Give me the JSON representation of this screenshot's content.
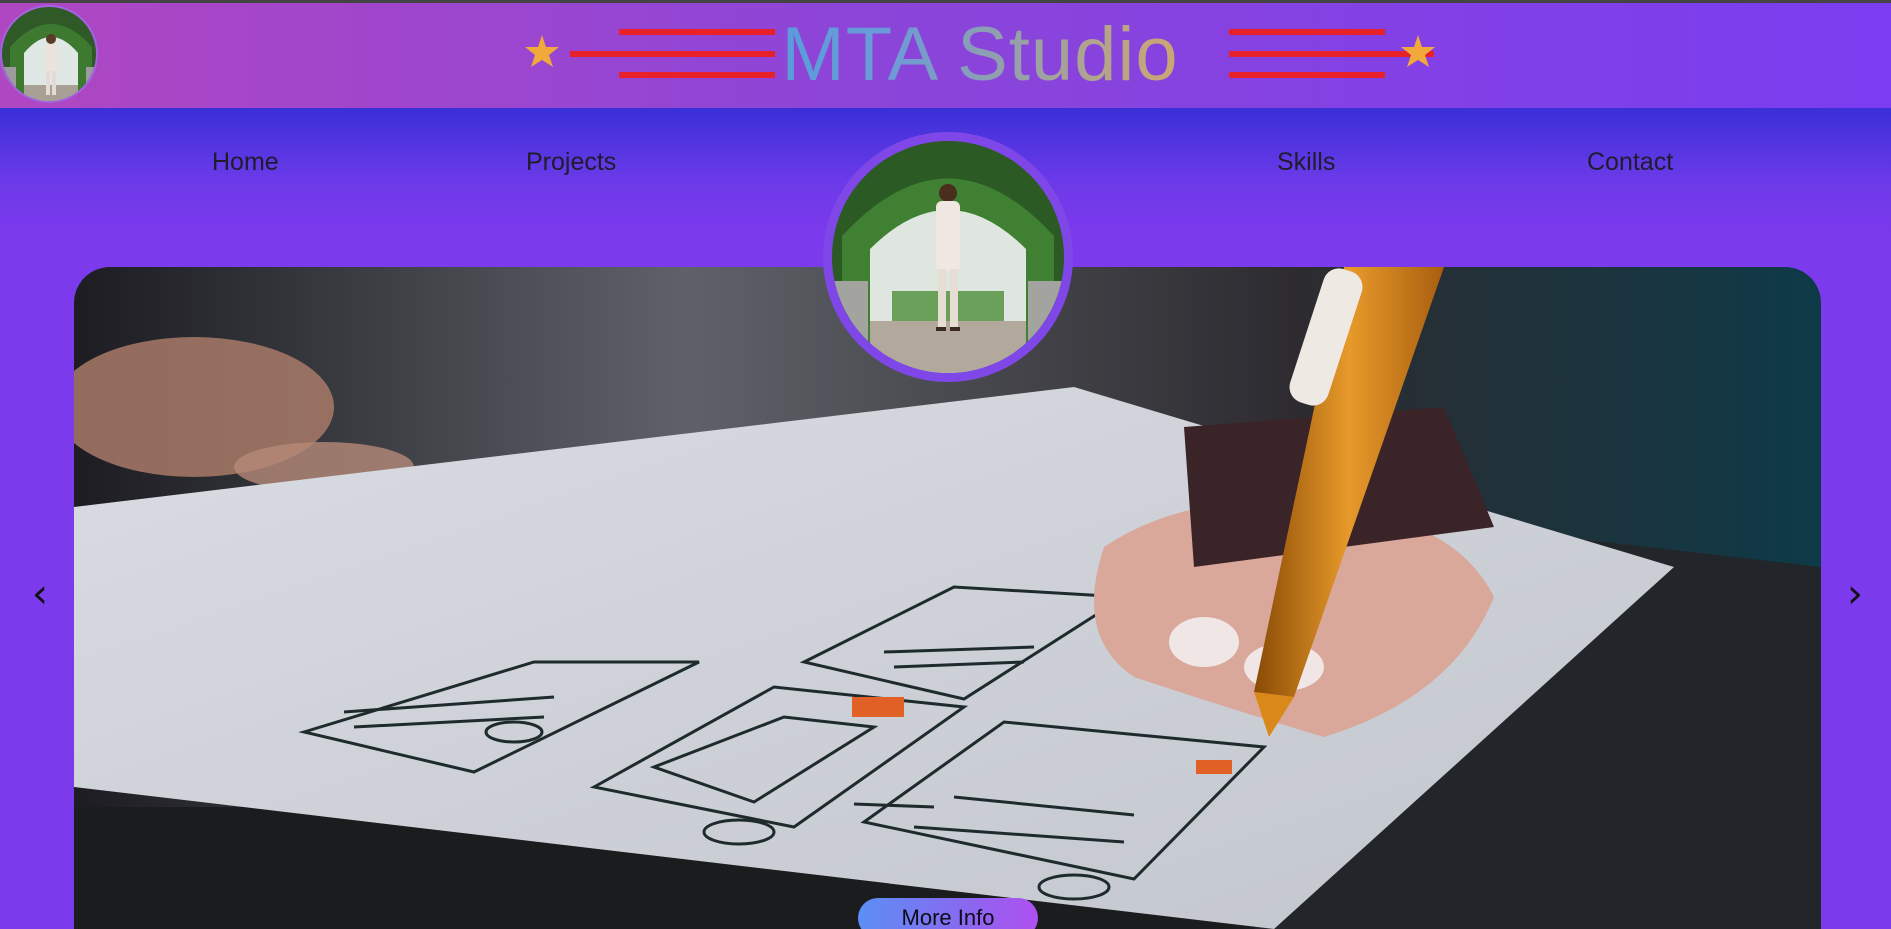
{
  "header": {
    "brand_title": "MTA Studio",
    "colors": {
      "background_start": "#b047c2",
      "background_end": "#7a3df0",
      "star": "#f0a93a",
      "stripes": "#e8202a"
    }
  },
  "nav": {
    "items": [
      {
        "label": "Home"
      },
      {
        "label": "Projects"
      },
      {
        "label": "Skills"
      },
      {
        "label": "Contact"
      }
    ]
  },
  "slider": {
    "prev_icon": "‹",
    "next_icon": "›",
    "button_label": "More Info"
  },
  "icons": {
    "prev": "chevron-left-icon",
    "next": "chevron-right-icon",
    "star": "star-icon"
  }
}
